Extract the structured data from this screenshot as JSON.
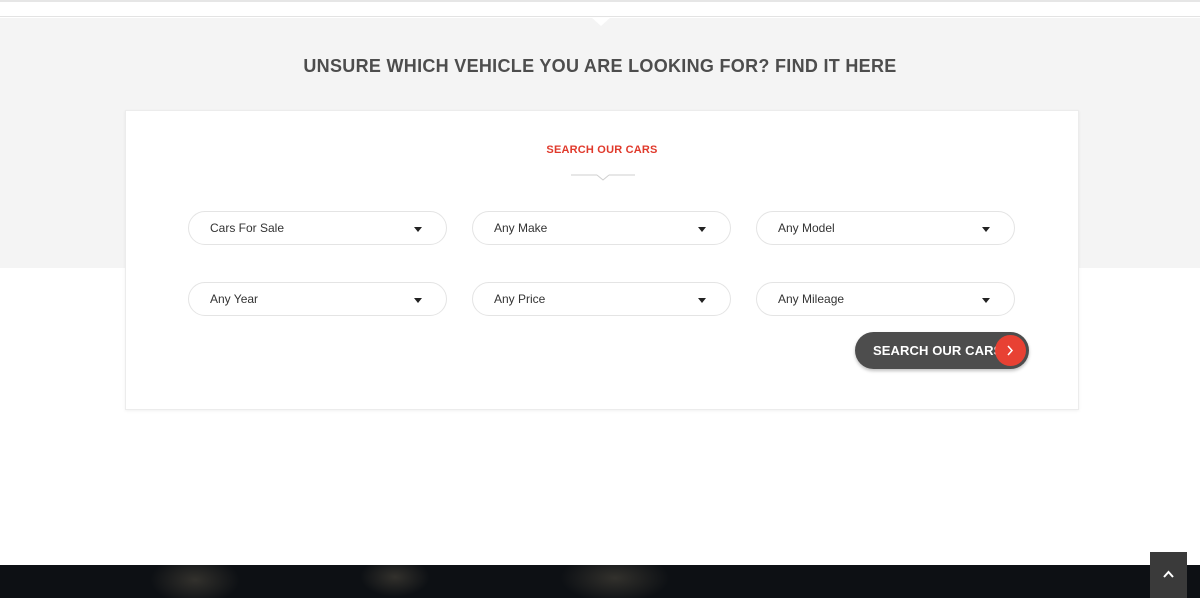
{
  "section": {
    "heading": "UNSURE WHICH VEHICLE YOU ARE LOOKING FOR? FIND IT HERE"
  },
  "search_form": {
    "title": "SEARCH OUR CARS",
    "selects": {
      "listing_type": "Cars For Sale",
      "make": "Any Make",
      "model": "Any Model",
      "year": "Any Year",
      "price": "Any Price",
      "mileage": "Any Mileage"
    },
    "submit_label": "SEARCH OUR CARS",
    "submit_icon": "chevron-right-icon"
  },
  "scroll_top": {
    "icon": "chevron-up-icon"
  },
  "colors": {
    "accent": "#e0392b",
    "button_dark": "#4d4d4d",
    "band_grey": "#f4f4f4",
    "footer_dark": "#0d1014"
  }
}
